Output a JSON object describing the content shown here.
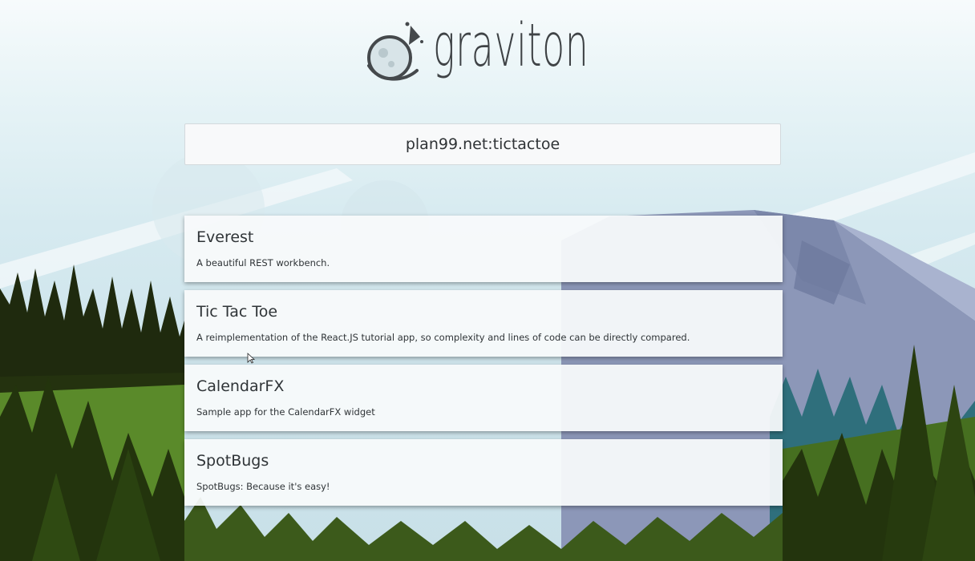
{
  "app": {
    "logo_text": "graviton",
    "logo_icon": "planet-rocket-icon"
  },
  "address_bar": {
    "value": "plan99.net:tictactoe"
  },
  "apps": [
    {
      "title": "Everest",
      "description": "A beautiful REST workbench."
    },
    {
      "title": "Tic Tac Toe",
      "description": "A reimplementation of the React.JS tutorial app, so complexity and lines of code can be directly compared."
    },
    {
      "title": "CalendarFX",
      "description": "Sample app for the CalendarFX widget"
    },
    {
      "title": "SpotBugs",
      "description": "SpotBugs: Because it's easy!"
    }
  ],
  "colors": {
    "sky": "#e6f3f6",
    "forest_dark": "#1f2a0e",
    "forest_green": "#4f7a24",
    "mountain": "#7f8fb0",
    "text": "#2f3437"
  }
}
